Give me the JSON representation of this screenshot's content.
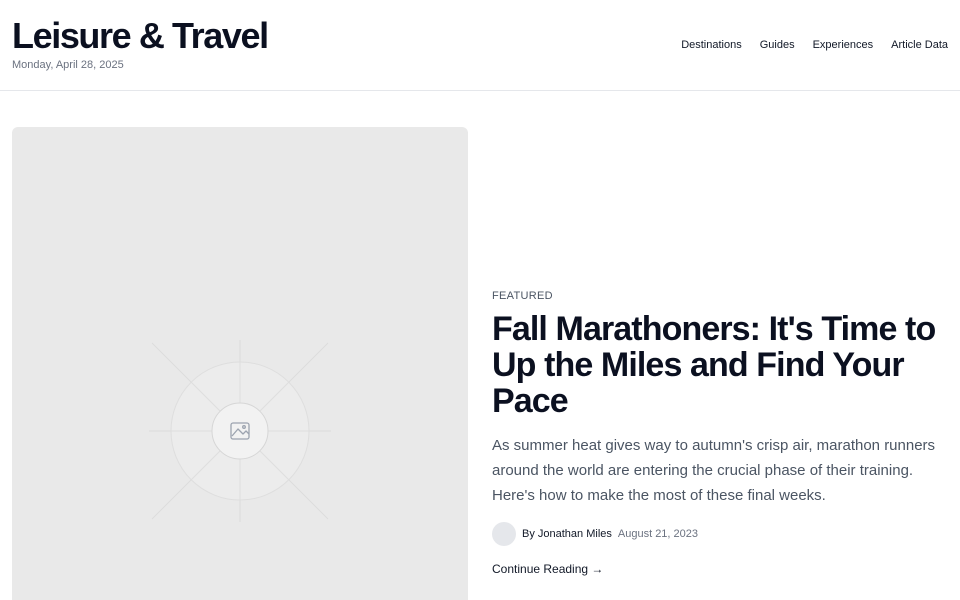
{
  "header": {
    "site_title": "Leisure & Travel",
    "date": "Monday, April 28, 2025",
    "nav": [
      "Destinations",
      "Guides",
      "Experiences",
      "Article Data"
    ]
  },
  "hero_image": {
    "icon": "image-placeholder-icon"
  },
  "article": {
    "kicker": "FEATURED",
    "headline": "Fall Marathoners: It's Time to Up the Miles and Find Your Pace",
    "excerpt": "As summer heat gives way to autumn's crisp air, marathon runners around the world are entering the crucial phase of their training. Here's how to make the most of these final weeks.",
    "author": "By Jonathan Miles",
    "date": "August 21, 2023",
    "cta": "Continue Reading →"
  }
}
